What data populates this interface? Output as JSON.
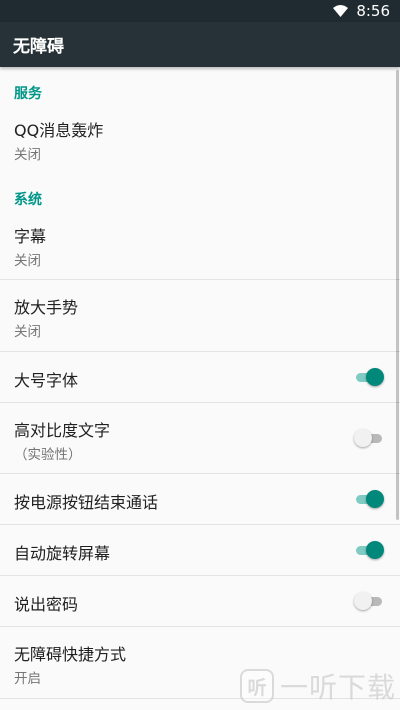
{
  "status_bar": {
    "time": "8:56",
    "icons": [
      "wifi-icon"
    ]
  },
  "app_bar": {
    "title": "无障碍"
  },
  "sections": [
    {
      "header": "服务",
      "items": [
        {
          "title": "QQ消息轰炸",
          "summary": "关闭"
        }
      ]
    },
    {
      "header": "系统",
      "items": [
        {
          "title": "字幕",
          "summary": "关闭"
        },
        {
          "title": "放大手势",
          "summary": "关闭"
        },
        {
          "title": "大号字体",
          "switch": true
        },
        {
          "title": "高对比度文字",
          "summary": "（实验性）",
          "switch": false
        },
        {
          "title": "按电源按钮结束通话",
          "switch": true
        },
        {
          "title": "自动旋转屏幕",
          "switch": true
        },
        {
          "title": "说出密码",
          "switch": false
        },
        {
          "title": "无障碍快捷方式",
          "summary": "开启"
        }
      ]
    }
  ],
  "watermark": {
    "icon_text": "听",
    "text": "一听下载"
  },
  "colors": {
    "status_bar": "#1f2b31",
    "app_bar": "#263238",
    "accent": "#009688",
    "switch_on_thumb": "#00897b",
    "switch_on_track": "#80cbc4"
  }
}
